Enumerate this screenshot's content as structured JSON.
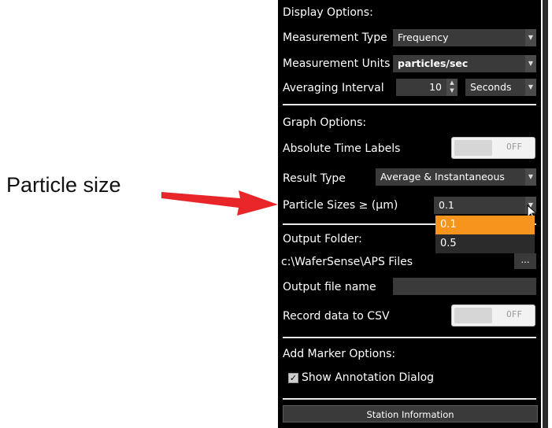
{
  "annotation": {
    "label": "Particle size"
  },
  "display": {
    "header": "Display Options:",
    "measurement_type": {
      "label": "Measurement Type",
      "value": "Frequency"
    },
    "measurement_units": {
      "label": "Measurement Units",
      "value": "particles/sec"
    },
    "averaging": {
      "label": "Averaging Interval",
      "value": "10",
      "unit": "Seconds"
    }
  },
  "graph": {
    "header": "Graph Options:",
    "absolute_time": {
      "label": "Absolute Time Labels",
      "state": "OFF"
    },
    "result_type": {
      "label": "Result Type",
      "value": "Average & Instantaneous"
    },
    "particle_sizes": {
      "label": "Particle Sizes ≥ (µm)",
      "value": "0.1",
      "options": [
        "0.1",
        "0.5"
      ],
      "highlighted": "0.1"
    }
  },
  "output": {
    "folder_label": "Output Folder:",
    "folder_path": "c:\\WaferSense\\APS Files",
    "browse_label": "...",
    "file_name_label": "Output file name",
    "file_name_value": "",
    "record_csv": {
      "label": "Record data to CSV",
      "state": "OFF"
    }
  },
  "marker": {
    "header": "Add Marker Options:",
    "show_annotation": {
      "label": "Show Annotation Dialog",
      "checked": true,
      "mark": "✓"
    }
  },
  "footer": {
    "station_button": "Station Information"
  },
  "colors": {
    "highlight": "#f7941d",
    "arrow": "#e8262a",
    "panel_bg": "#000000"
  }
}
